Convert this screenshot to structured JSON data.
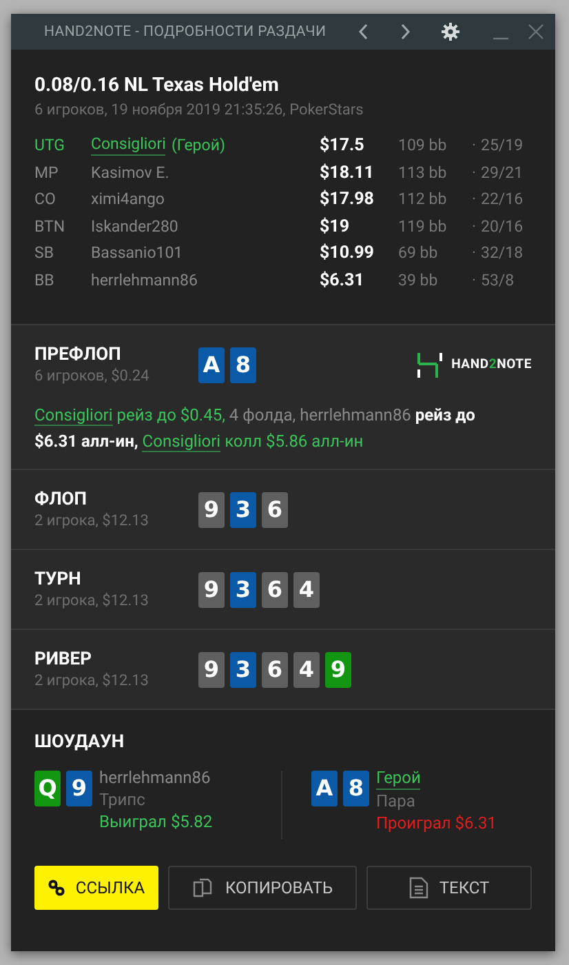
{
  "window": {
    "title": "HAND2NOTE - ПОДРОБНОСТИ РАЗДАЧИ"
  },
  "hand": {
    "title": "0.08/0.16 NL Texas Hold'em",
    "subtitle": "6 игроков, 19 ноября 2019 21:35:26, PokerStars"
  },
  "players": [
    {
      "position": "UTG",
      "name": "Consigliori",
      "hero_tag": "(Герой)",
      "hero": true,
      "stack": "$17.5",
      "bb": "109 bb",
      "separator": "·",
      "stats": "25/19"
    },
    {
      "position": "MP",
      "name": "Kasimov E.",
      "hero": false,
      "stack": "$18.11",
      "bb": "113 bb",
      "separator": "·",
      "stats": "29/21"
    },
    {
      "position": "CO",
      "name": "ximi4ango",
      "hero": false,
      "stack": "$17.98",
      "bb": "112 bb",
      "separator": "·",
      "stats": "22/16"
    },
    {
      "position": "BTN",
      "name": "Iskander280",
      "hero": false,
      "stack": "$19",
      "bb": "119 bb",
      "separator": "·",
      "stats": "20/16"
    },
    {
      "position": "SB",
      "name": "Bassanio101",
      "hero": false,
      "stack": "$10.99",
      "bb": "69 bb",
      "separator": "·",
      "stats": "32/18"
    },
    {
      "position": "BB",
      "name": "herrlehmann86",
      "hero": false,
      "stack": "$6.31",
      "bb": "39 bb",
      "separator": "·",
      "stats": "53/8"
    }
  ],
  "streets": [
    {
      "name": "ПРЕФЛОП",
      "info": "6 игроков, $0.24",
      "cards": [
        {
          "rank": "A",
          "color": "#0b5aa8"
        },
        {
          "rank": "8",
          "color": "#0b5aa8"
        }
      ],
      "logo": {
        "prefix": "HAND",
        "accent": "2",
        "suffix": "NOTE"
      },
      "actions": [
        {
          "kind": "link",
          "text": "Consigliori"
        },
        {
          "kind": "hero",
          "text": " рейз до $0.45,"
        },
        {
          "kind": "muted",
          "text": " 4 фолда, herrlehmann86"
        },
        {
          "kind": "strong",
          "text": " рейз до $6.31 алл-ин, "
        },
        {
          "kind": "link",
          "text": "Consigliori"
        },
        {
          "kind": "hero",
          "text": " колл $5.86 алл-ин"
        }
      ]
    },
    {
      "name": "ФЛОП",
      "info": "2 игрока, $12.13",
      "cards": [
        {
          "rank": "9",
          "color": "#5f5f5f"
        },
        {
          "rank": "3",
          "color": "#0b5aa8"
        },
        {
          "rank": "6",
          "color": "#5f5f5f"
        }
      ]
    },
    {
      "name": "ТУРН",
      "info": "2 игрока, $12.13",
      "cards": [
        {
          "rank": "9",
          "color": "#5f5f5f"
        },
        {
          "rank": "3",
          "color": "#0b5aa8"
        },
        {
          "rank": "6",
          "color": "#5f5f5f"
        },
        {
          "rank": "4",
          "color": "#5f5f5f"
        }
      ]
    },
    {
      "name": "РИВЕР",
      "info": "2 игрока, $12.13",
      "cards": [
        {
          "rank": "9",
          "color": "#5f5f5f"
        },
        {
          "rank": "3",
          "color": "#0b5aa8"
        },
        {
          "rank": "6",
          "color": "#5f5f5f"
        },
        {
          "rank": "4",
          "color": "#5f5f5f"
        },
        {
          "rank": "9",
          "color": "#129612"
        }
      ]
    }
  ],
  "showdown": {
    "title": "ШОУДАУН",
    "hands": [
      {
        "cards": [
          {
            "rank": "Q",
            "color": "#129612"
          },
          {
            "rank": "9",
            "color": "#0b5aa8"
          }
        ],
        "player": "herrlehmann86",
        "hero": false,
        "combo": "Трипс",
        "result": "Выиграл $5.82",
        "won": true
      },
      {
        "cards": [
          {
            "rank": "A",
            "color": "#0b5aa8"
          },
          {
            "rank": "8",
            "color": "#0b5aa8"
          }
        ],
        "player": "Герой",
        "hero": true,
        "combo": "Пара",
        "result": "Проиграл $6.31",
        "won": false
      }
    ]
  },
  "buttons": [
    {
      "kind": "link",
      "label": "ССЫЛКА"
    },
    {
      "kind": "copy",
      "label": "КОПИРОВАТЬ"
    },
    {
      "kind": "text",
      "label": "ТЕКСТ"
    }
  ]
}
